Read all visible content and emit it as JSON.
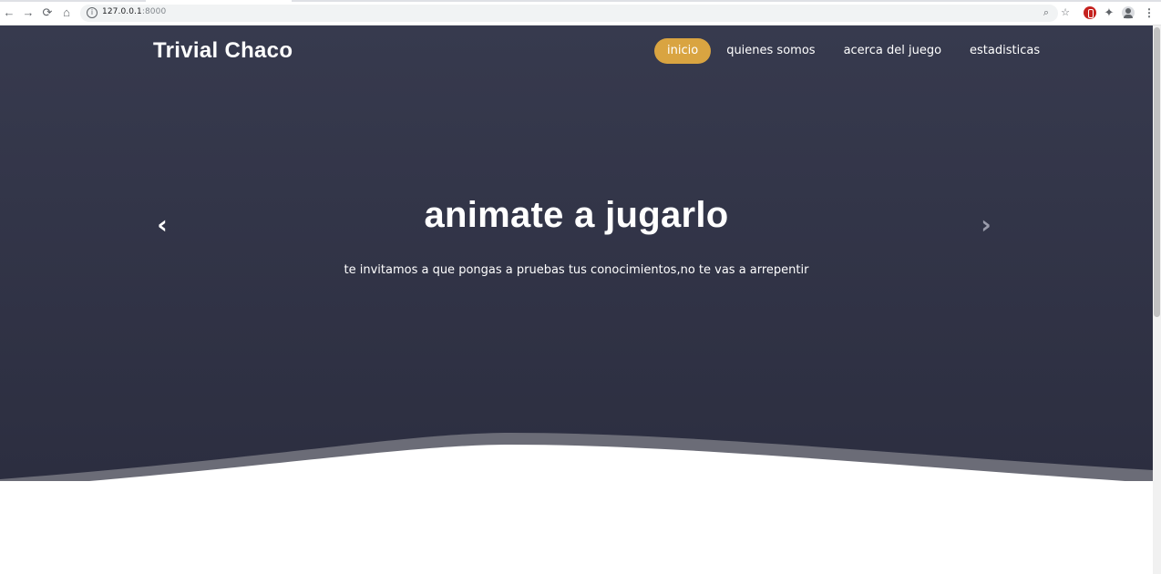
{
  "browser": {
    "url_host": "127.0.0.1",
    "url_port": ":8000",
    "back_icon": "back-arrow-icon",
    "forward_icon": "forward-arrow-icon",
    "reload_icon": "reload-icon",
    "home_icon": "home-icon"
  },
  "site": {
    "brand": "Trivial Chaco",
    "nav": [
      {
        "label": "inicio",
        "active": true
      },
      {
        "label": "quienes somos",
        "active": false
      },
      {
        "label": "acerca del juego",
        "active": false
      },
      {
        "label": "estadisticas",
        "active": false
      }
    ]
  },
  "hero": {
    "headline": "animate a jugarlo",
    "subtitle": "te invitamos a que pongas a pruebas tus conocimientos,no te vas a arrepentir",
    "prev_glyph": "‹",
    "next_glyph": "›"
  },
  "colors": {
    "hero_bg": "#2f3144",
    "accent": "#d9a441"
  }
}
